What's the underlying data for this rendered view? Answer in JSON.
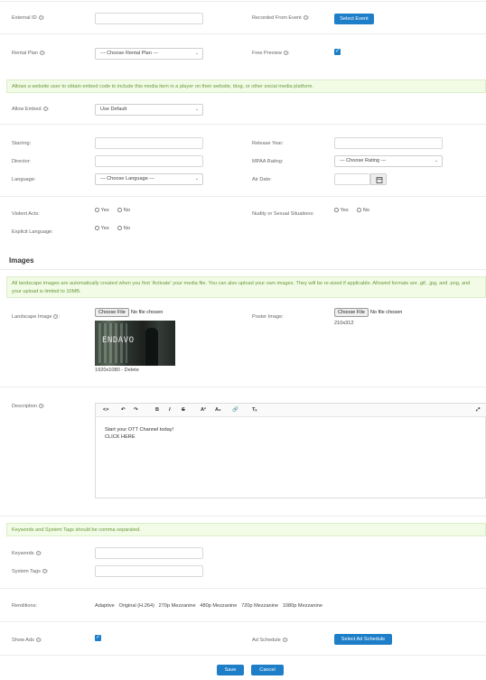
{
  "top_section": {
    "external_id_label": "External ID",
    "recorded_from_event_label": "Recorded From Event",
    "select_event_button": "Select Event",
    "rental_plan_label": "Rental Plan",
    "rental_plan_value": "--- Choose Rental Plan ---",
    "free_preview_label": "Free Preview",
    "free_preview_checked": true
  },
  "embed_notice": "Allows a website user to obtain embed code to include this media item in a player on their website, blog, or other social media platform.",
  "allow_embed": {
    "label": "Allow Embed",
    "value": "Use Default"
  },
  "credits": {
    "starring_label": "Starring:",
    "release_year_label": "Release Year:",
    "director_label": "Director:",
    "mpaa_label": "MPAA Rating:",
    "mpaa_value": "--- Choose Rating ---",
    "language_label": "Language:",
    "language_value": "--- Choose Language ---",
    "air_date_label": "Air Date:"
  },
  "content_flags": {
    "violent_label": "Violent Acts:",
    "nudity_label": "Nudity or Sexual Situations:",
    "explicit_label": "Explicit Language:",
    "yes": "Yes",
    "no": "No"
  },
  "images": {
    "heading": "Images",
    "notice": "All landscape images are automatically created when you first 'Activate' your media file. You can also upload your own images. They will be re-sized if applicable. Allowed formats are .gif, .jpg, and .png, and your upload is limited to 10MB.",
    "landscape_label": "Landscape Image",
    "choose_file": "Choose File",
    "no_file": "No file chosen",
    "thumb_text": "ENDAVO",
    "landscape_meta": "1920x1080 -",
    "delete_link": "Delete",
    "poster_label": "Poster Image:",
    "poster_size": "210x312"
  },
  "description": {
    "label": "Description",
    "line1": "Start your OTT Channel today!",
    "line2": "CLICK HERE"
  },
  "keywords_notice": "Keywords and System Tags should be comma separated.",
  "keywords_label": "Keywords",
  "system_tags_label": "System Tags",
  "renditions": {
    "label": "Renditions:",
    "items": [
      "Adaptive",
      "Original (H.264)",
      "270p Mezzanine",
      "480p Mezzanine",
      "720p Mezzanine",
      "1080p Mezzanine"
    ]
  },
  "ads": {
    "show_ads_label": "Show Ads",
    "show_ads_checked": true,
    "ad_schedule_label": "Ad Schedule",
    "select_ad_schedule_button": "Select Ad Schedule"
  },
  "footer": {
    "save": "Save",
    "cancel": "Cancel"
  },
  "colors": {
    "accent": "#1e7ec8",
    "notice_bg": "#f1fbe6",
    "notice_text": "#6b9a3c"
  }
}
